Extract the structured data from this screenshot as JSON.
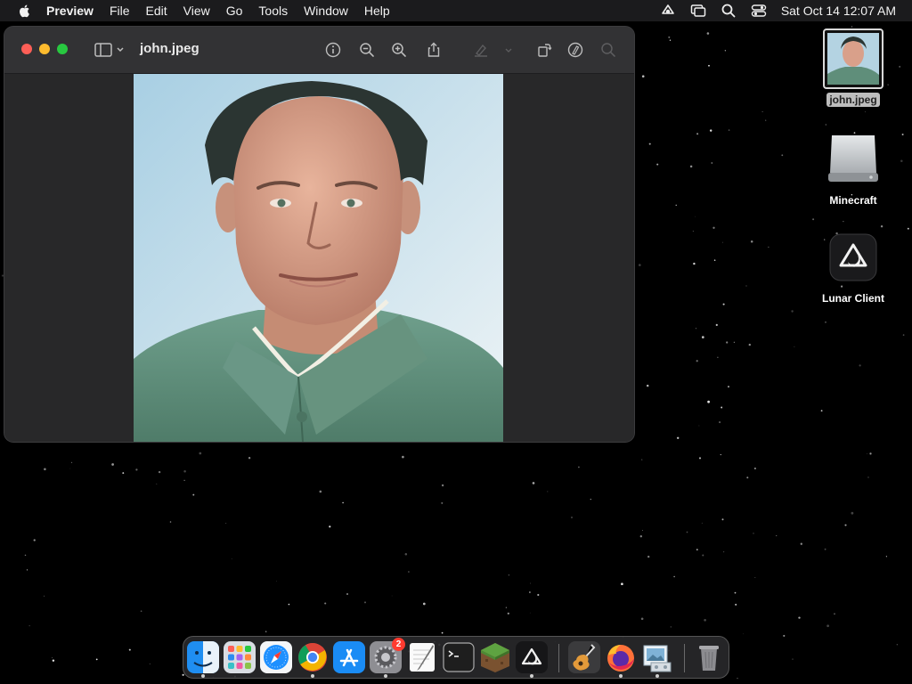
{
  "menubar": {
    "app_name": "Preview",
    "items": [
      "File",
      "Edit",
      "View",
      "Go",
      "Tools",
      "Window",
      "Help"
    ],
    "clock": "Sat Oct 14  12:07 AM"
  },
  "window": {
    "title": "john.jpeg"
  },
  "desktop": {
    "icons": [
      {
        "label": "john.jpeg",
        "selected": true
      },
      {
        "label": "Minecraft"
      },
      {
        "label": "Lunar Client"
      }
    ]
  },
  "dock": {
    "settings_badge": "2",
    "icons": [
      "finder-icon",
      "launchpad-icon",
      "safari-icon",
      "chrome-icon",
      "app-store-icon",
      "system-settings-icon",
      "textedit-icon",
      "terminal-icon",
      "minecraft-icon",
      "lunar-client-icon",
      "garageband-icon",
      "firefox-icon",
      "preview-icon",
      "trash-icon"
    ]
  },
  "colors": {
    "close": "#fe5f57",
    "minimize": "#febc2e",
    "maximize": "#28c840",
    "menubar": "#1b1b1d",
    "window": "#2b2b2d"
  }
}
